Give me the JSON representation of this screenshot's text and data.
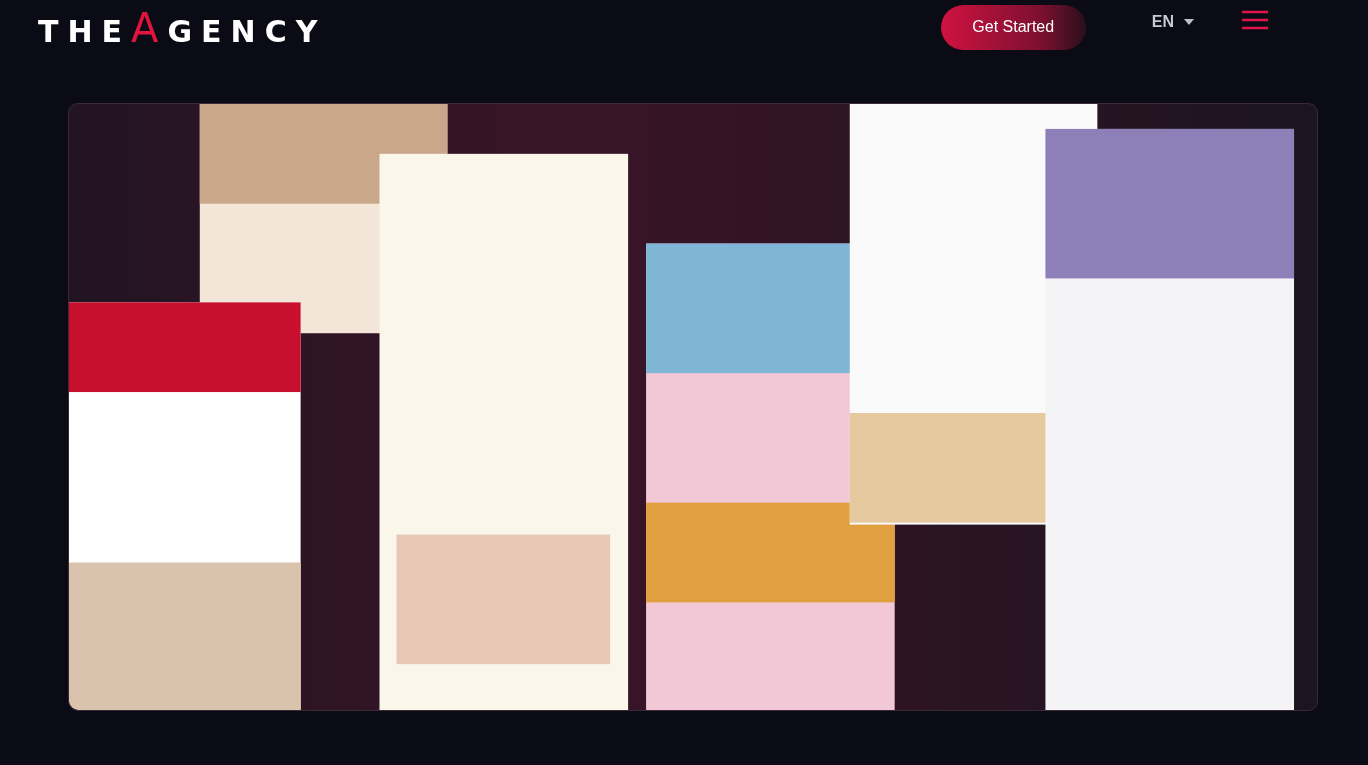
{
  "header": {
    "logo": {
      "before": "THE",
      "accent": "A",
      "after": "GENCY"
    },
    "cta": "Get Started",
    "language": "EN"
  }
}
